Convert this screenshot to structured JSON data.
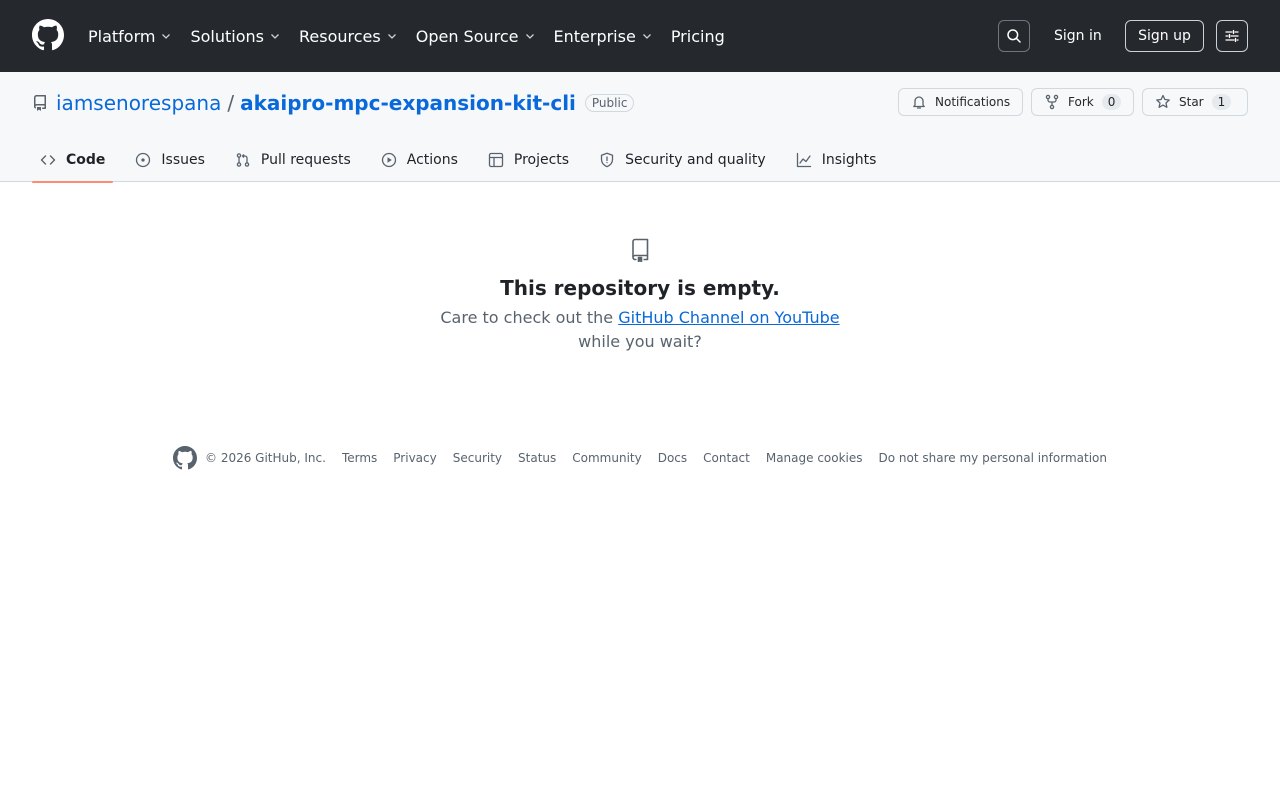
{
  "header": {
    "nav": [
      {
        "label": "Platform",
        "has_dropdown": true
      },
      {
        "label": "Solutions",
        "has_dropdown": true
      },
      {
        "label": "Resources",
        "has_dropdown": true
      },
      {
        "label": "Open Source",
        "has_dropdown": true
      },
      {
        "label": "Enterprise",
        "has_dropdown": true
      },
      {
        "label": "Pricing",
        "has_dropdown": false
      }
    ],
    "sign_in": "Sign in",
    "sign_up": "Sign up"
  },
  "repo": {
    "owner": "iamsenorespana",
    "separator": "/",
    "name": "akaipro-mpc-expansion-kit-cli",
    "visibility": "Public",
    "notifications_label": "Notifications",
    "fork_label": "Fork",
    "fork_count": "0",
    "star_label": "Star",
    "star_count": "1"
  },
  "tabs": [
    {
      "label": "Code",
      "icon": "code-icon",
      "active": true
    },
    {
      "label": "Issues",
      "icon": "issue-icon"
    },
    {
      "label": "Pull requests",
      "icon": "pull-request-icon"
    },
    {
      "label": "Actions",
      "icon": "play-icon"
    },
    {
      "label": "Projects",
      "icon": "table-icon"
    },
    {
      "label": "Security and quality",
      "icon": "shield-icon"
    },
    {
      "label": "Insights",
      "icon": "graph-icon"
    }
  ],
  "empty": {
    "title": "This repository is empty.",
    "text_before": "Care to check out the ",
    "link": "GitHub Channel on YouTube",
    "text_after": "while you wait?"
  },
  "footer": {
    "copyright": "© 2026 GitHub, Inc.",
    "links": [
      "Terms",
      "Privacy",
      "Security",
      "Status",
      "Community",
      "Docs",
      "Contact",
      "Manage cookies",
      "Do not share my personal information"
    ]
  },
  "colors": {
    "header_bg": "#25292e",
    "link": "#0969da",
    "active_tab_underline": "#fd8c73"
  }
}
